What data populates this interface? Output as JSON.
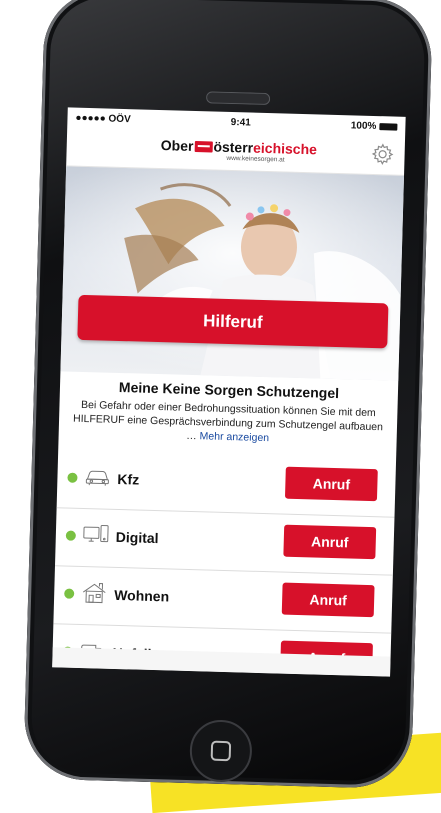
{
  "status_bar": {
    "carrier": "●●●●● OÖV",
    "time": "9:41",
    "battery": "100%"
  },
  "header": {
    "brand_part1": "Ober",
    "brand_part2": "österr",
    "brand_part3": "eichische",
    "brand_url": "www.keinesorgen.at",
    "settings_icon": "gear-icon"
  },
  "hero": {
    "help_button_label": "Hilferuf"
  },
  "info": {
    "title": "Meine Keine Sorgen Schutzengel",
    "description": "Bei Gefahr oder einer Bedrohungssituation können Sie mit dem HILFERUF eine Gesprächsverbindung zum Schutzengel aufbauen … ",
    "more_link": "Mehr anzeigen"
  },
  "services": [
    {
      "label": "Kfz",
      "icon": "car-icon",
      "button_label": "Anruf"
    },
    {
      "label": "Digital",
      "icon": "devices-icon",
      "button_label": "Anruf"
    },
    {
      "label": "Wohnen",
      "icon": "house-icon",
      "button_label": "Anruf"
    },
    {
      "label": "Unfall",
      "icon": "ambulance-icon",
      "button_label": "Anruf"
    }
  ],
  "colors": {
    "brand_red": "#d7112a",
    "status_green": "#7ac142",
    "link_blue": "#1a4aa0"
  }
}
